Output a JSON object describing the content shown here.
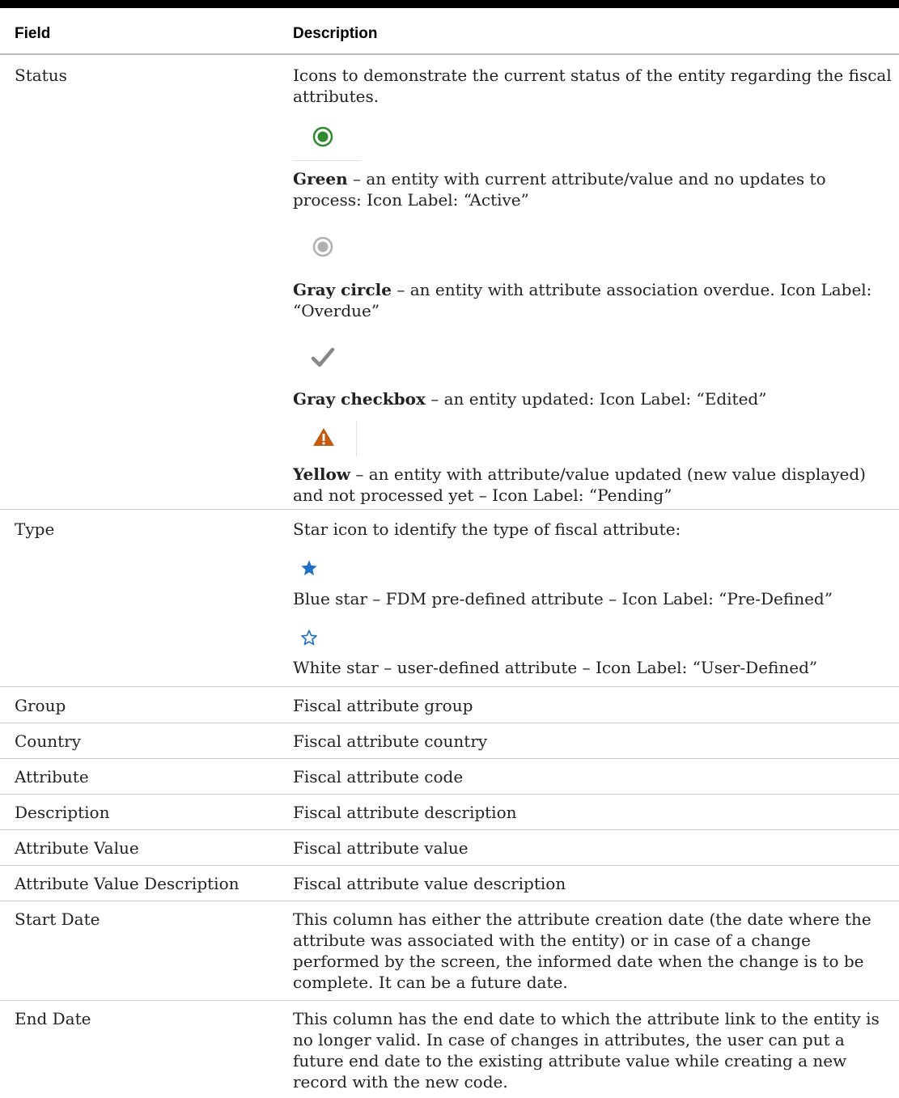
{
  "table": {
    "headers": {
      "field": "Field",
      "description": "Description"
    },
    "status": {
      "field": "Status",
      "intro": "Icons to demonstrate the current status of the entity regarding the fiscal attributes.",
      "items": [
        {
          "icon": "green-circle-icon",
          "color": "#2f8a2f",
          "bold": "Green",
          "text": " – an entity with current attribute/value and no updates to process: Icon Label: “Active”"
        },
        {
          "icon": "gray-circle-icon",
          "color": "#a8a8a8",
          "bold": "Gray circle",
          "text": " – an entity with attribute association overdue. Icon Label: “Overdue”"
        },
        {
          "icon": "gray-check-icon",
          "color": "#888888",
          "bold": "Gray checkbox",
          "text": " – an entity updated: Icon Label: “Edited”"
        },
        {
          "icon": "warning-triangle-icon",
          "color": "#c55a11",
          "bold": "Yellow",
          "text": " – an entity with attribute/value updated (new value displayed) and not processed yet – Icon Label: “Pending”"
        }
      ]
    },
    "type": {
      "field": "Type",
      "intro": "Star icon to identify the type of fiscal attribute:",
      "blue_star": "Blue star – FDM pre-defined attribute – Icon Label: “Pre-Defined”",
      "white_star": "White star – user-defined attribute – Icon Label: “User-Defined”",
      "star_color": "#1f6fc4"
    },
    "rows": [
      {
        "field": "Group",
        "description": "Fiscal attribute group"
      },
      {
        "field": "Country",
        "description": "Fiscal attribute country"
      },
      {
        "field": "Attribute",
        "description": "Fiscal attribute code"
      },
      {
        "field": "Description",
        "description": "Fiscal attribute description"
      },
      {
        "field": "Attribute Value",
        "description": "Fiscal attribute value"
      },
      {
        "field": "Attribute Value Description",
        "description": "Fiscal attribute value description"
      },
      {
        "field": "Start Date",
        "description": "This column has either the attribute creation date (the date where the attribute was associated with the entity) or in case of a change performed by the screen, the informed date when the change is to be complete. It can be a future date."
      },
      {
        "field": "End Date",
        "description": "This column has the end date to which the attribute link to the entity is no longer valid. In case of changes in attributes, the user can put a future end date to the existing attribute value while creating a new record with the new code."
      }
    ]
  }
}
